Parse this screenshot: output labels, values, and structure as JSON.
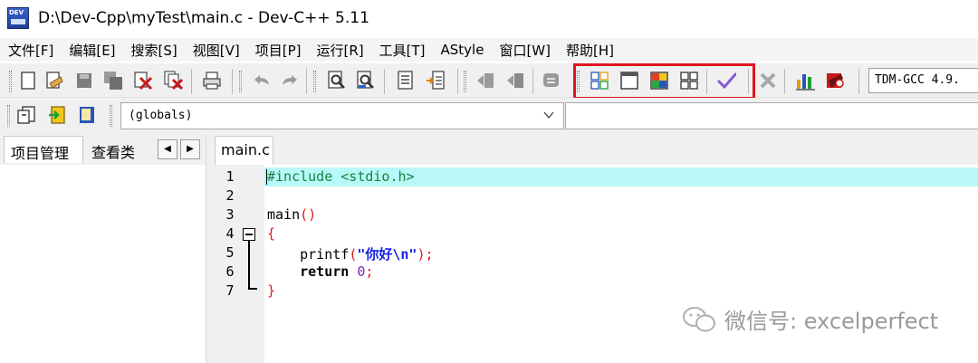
{
  "window": {
    "title": "D:\\Dev-Cpp\\myTest\\main.c - Dev-C++ 5.11"
  },
  "menu": [
    "文件[F]",
    "编辑[E]",
    "搜索[S]",
    "视图[V]",
    "项目[P]",
    "运行[R]",
    "工具[T]",
    "AStyle",
    "窗口[W]",
    "帮助[H]"
  ],
  "toolbar": {
    "compiler_select": "TDM-GCC 4.9.",
    "icons": [
      "new-file-icon",
      "open-file-icon",
      "save-icon",
      "save-all-icon",
      "close-icon",
      "close-all-icon",
      "print-icon",
      "undo-icon",
      "redo-icon",
      "find-icon",
      "replace-icon",
      "goto-line-icon",
      "jump-icon",
      "indent-icon",
      "unindent-icon",
      "toggle-comment-icon",
      "layout-grid-icon",
      "window-icon",
      "multi-window-icon",
      "tile-icon",
      "check-icon",
      "stop-icon",
      "chart-icon",
      "debug-icon"
    ]
  },
  "toolbar2": {
    "scope_select": "(globals)"
  },
  "left_panel": {
    "tabs": [
      "项目管理",
      "查看类"
    ]
  },
  "editor": {
    "tab": "main.c",
    "line_numbers": [
      "1",
      "2",
      "3",
      "4",
      "5",
      "6",
      "7"
    ],
    "code": {
      "l1": "#include <stdio.h>",
      "l3_fn": "main",
      "l3_paren": "()",
      "l4": "{",
      "l5_fn": "    printf",
      "l5_open": "(",
      "l5_str": "\"你好\\n\"",
      "l5_close": ");",
      "l6_kw": "    return",
      "l6_sp": " ",
      "l6_num": "0",
      "l6_semi": ";",
      "l7": "}"
    }
  },
  "watermark": {
    "text": "微信号: excelperfect"
  },
  "colors": {
    "highlight_line": "#b8f8f8",
    "annotation_box": "#e0141c"
  }
}
